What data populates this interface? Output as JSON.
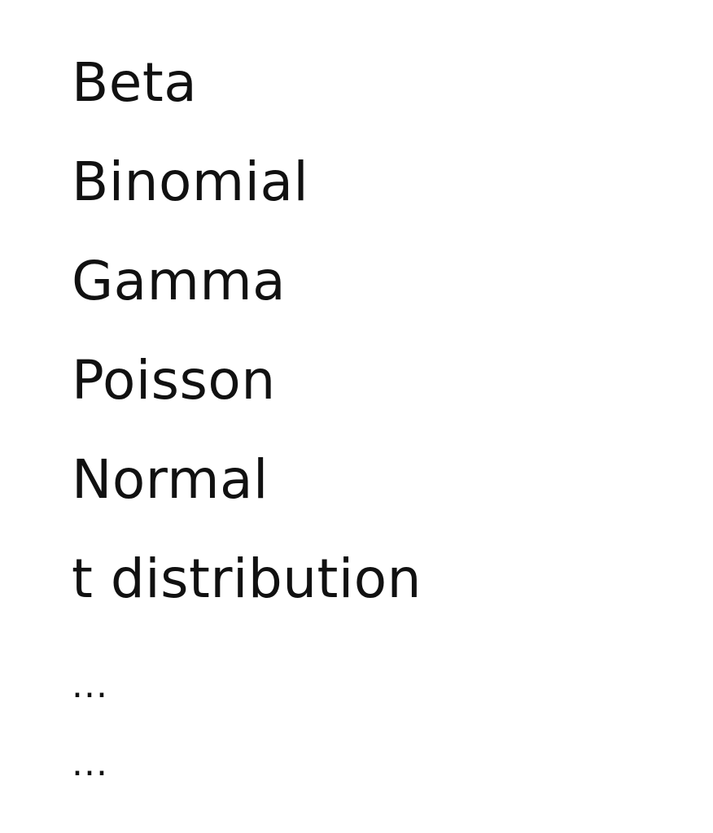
{
  "items": [
    "Beta",
    "Binomial",
    "Gamma",
    "Poisson",
    "Normal",
    "t distribution",
    "...",
    "..."
  ]
}
